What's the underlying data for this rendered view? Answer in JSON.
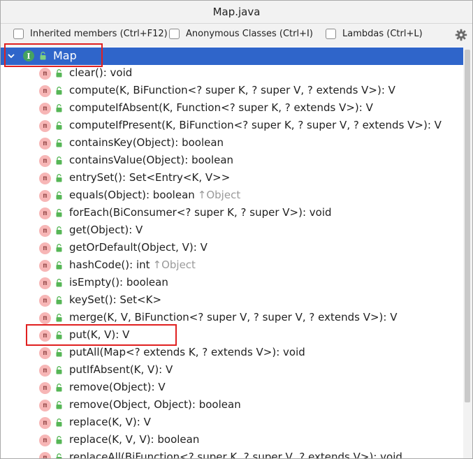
{
  "window": {
    "title": "Map.java"
  },
  "toolbar": {
    "inherited_label": "Inherited members (Ctrl+F12)",
    "anonymous_label": "Anonymous Classes (Ctrl+I)",
    "lambdas_label": "Lambdas (Ctrl+L)"
  },
  "tree": {
    "root": {
      "badge": "I",
      "label": "Map"
    },
    "method_badge": "m",
    "items": [
      {
        "sig": "clear(): void"
      },
      {
        "sig": "compute(K, BiFunction<? super K, ? super V, ? extends V>): V"
      },
      {
        "sig": "computeIfAbsent(K, Function<? super K, ? extends V>): V"
      },
      {
        "sig": "computeIfPresent(K, BiFunction<? super K, ? super V, ? extends V>): V"
      },
      {
        "sig": "containsKey(Object): boolean"
      },
      {
        "sig": "containsValue(Object): boolean"
      },
      {
        "sig": "entrySet(): Set<Entry<K, V>>"
      },
      {
        "sig": "equals(Object): boolean",
        "inherited": "↑Object"
      },
      {
        "sig": "forEach(BiConsumer<? super K, ? super V>): void"
      },
      {
        "sig": "get(Object): V"
      },
      {
        "sig": "getOrDefault(Object, V): V"
      },
      {
        "sig": "hashCode(): int",
        "inherited": "↑Object"
      },
      {
        "sig": "isEmpty(): boolean"
      },
      {
        "sig": "keySet(): Set<K>"
      },
      {
        "sig": "merge(K, V, BiFunction<? super V, ? super V, ? extends V>): V"
      },
      {
        "sig": "put(K, V): V"
      },
      {
        "sig": "putAll(Map<? extends K, ? extends V>): void"
      },
      {
        "sig": "putIfAbsent(K, V): V"
      },
      {
        "sig": "remove(Object): V"
      },
      {
        "sig": "remove(Object, Object): boolean"
      },
      {
        "sig": "replace(K, V): V"
      },
      {
        "sig": "replace(K, V, V): boolean"
      },
      {
        "sig": "replaceAll(BiFunction<? super K, ? super V, ? extends V>): void"
      }
    ]
  },
  "colors": {
    "selection": "#2f65ca",
    "interface_badge": "#46a261",
    "method_badge": "#f7b6b6",
    "highlight": "#e02020"
  }
}
